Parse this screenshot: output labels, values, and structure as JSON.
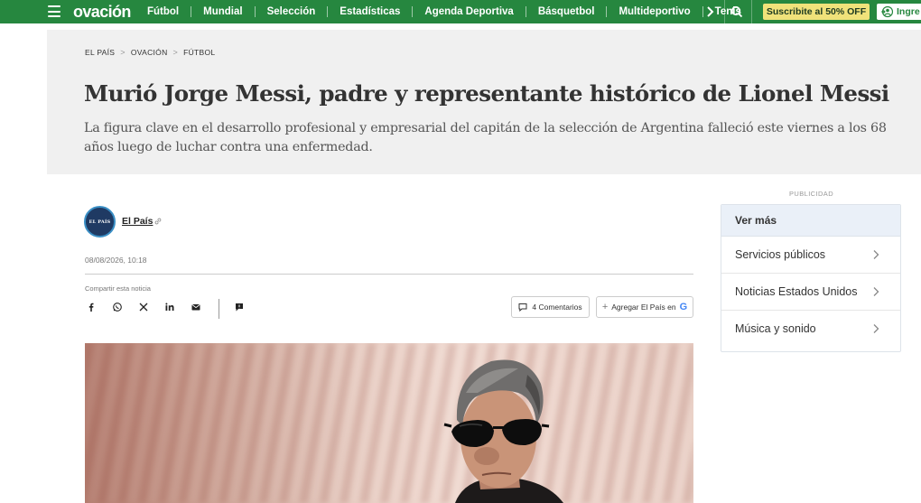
{
  "nav": {
    "logo": "ovación",
    "links": [
      "Fútbol",
      "Mundial",
      "Selección",
      "Estadísticas",
      "Agenda Deportiva",
      "Básquetbol",
      "Multideportivo",
      "Tenis"
    ],
    "subscribe_label": "Suscribite al 50% OFF",
    "login_label": "Ingre",
    "color": "#26873f"
  },
  "breadcrumb": [
    "EL PAÍS",
    "OVACIÓN",
    "FÚTBOL"
  ],
  "article": {
    "headline": "Murió Jorge Messi, padre y representante histórico de Lionel Messi",
    "subhead": "La figura clave en el desarrollo profesional y empresarial del capitán de la selección de Argentina falleció este viernes a los 68 años luego de luchar contra una enfermedad.",
    "author": "El País",
    "avatar_text": "EL PAÍS",
    "timestamp": "08/08/2026, 10:18",
    "share_label": "Compartir esta noticia",
    "comments_label": "4 Comentarios",
    "google_label": "Agregar El País en",
    "google_letter": "G"
  },
  "sidebar": {
    "ad_label": "PUBLICIDAD",
    "title": "Ver más",
    "items": [
      "Servicios públicos",
      "Noticias Estados Unidos",
      "Música y sonido"
    ]
  }
}
